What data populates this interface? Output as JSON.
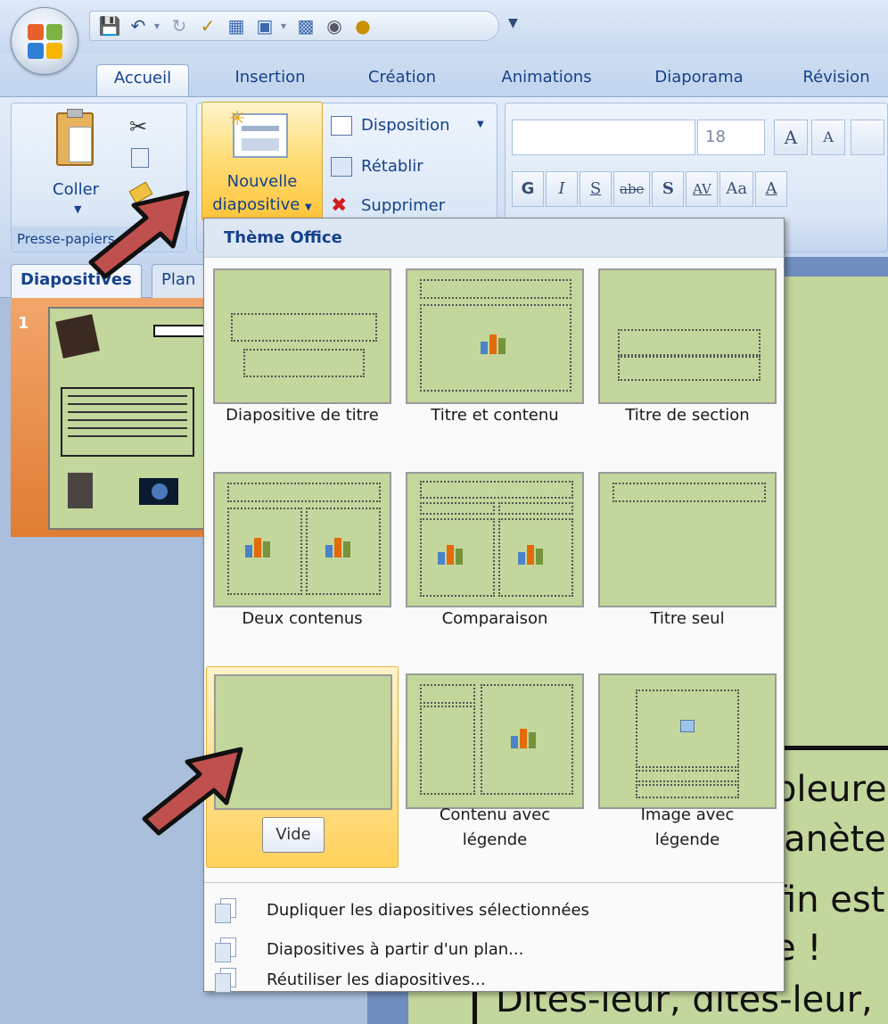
{
  "ribbon_tabs": [
    "Accueil",
    "Insertion",
    "Création",
    "Animations",
    "Diaporama",
    "Révision"
  ],
  "clipboard": {
    "paste_label": "Coller",
    "group_label": "Presse-papiers"
  },
  "slides_group": {
    "new_slide_line1": "Nouvelle",
    "new_slide_line2": "diapositive",
    "layout_label": "Disposition",
    "reset_label": "Rétablir",
    "delete_label": "Supprimer"
  },
  "font_group": {
    "font_size": "18",
    "bold": "G",
    "italic": "I",
    "underline": "S",
    "strike": "abe",
    "shadow": "S",
    "spacing": "AV",
    "case": "Aa",
    "color": "A"
  },
  "panel_tabs": [
    "Diapositives",
    "Plan"
  ],
  "thumbnail": {
    "number": "1"
  },
  "gallery": {
    "header": "Thème Office",
    "layouts": [
      {
        "label": "Diapositive de titre"
      },
      {
        "label": "Titre et contenu"
      },
      {
        "label": "Titre de section"
      },
      {
        "label": "Deux contenus"
      },
      {
        "label": "Comparaison"
      },
      {
        "label": "Titre seul"
      },
      {
        "label": "Vide"
      },
      {
        "label_line1": "Contenu avec",
        "label_line2": "légende"
      },
      {
        "label_line1": "Image avec",
        "label_line2": "légende"
      }
    ],
    "tooltip": "Vide",
    "menu_items": [
      "Dupliquer les diapositives sélectionnées",
      "Diapositives à partir d'un plan...",
      "Réutiliser les diapositives..."
    ]
  },
  "slide_text": [
    "pleure",
    "lanète",
    "fin est",
    "e !",
    "Dites-leur, dites-leur,"
  ]
}
